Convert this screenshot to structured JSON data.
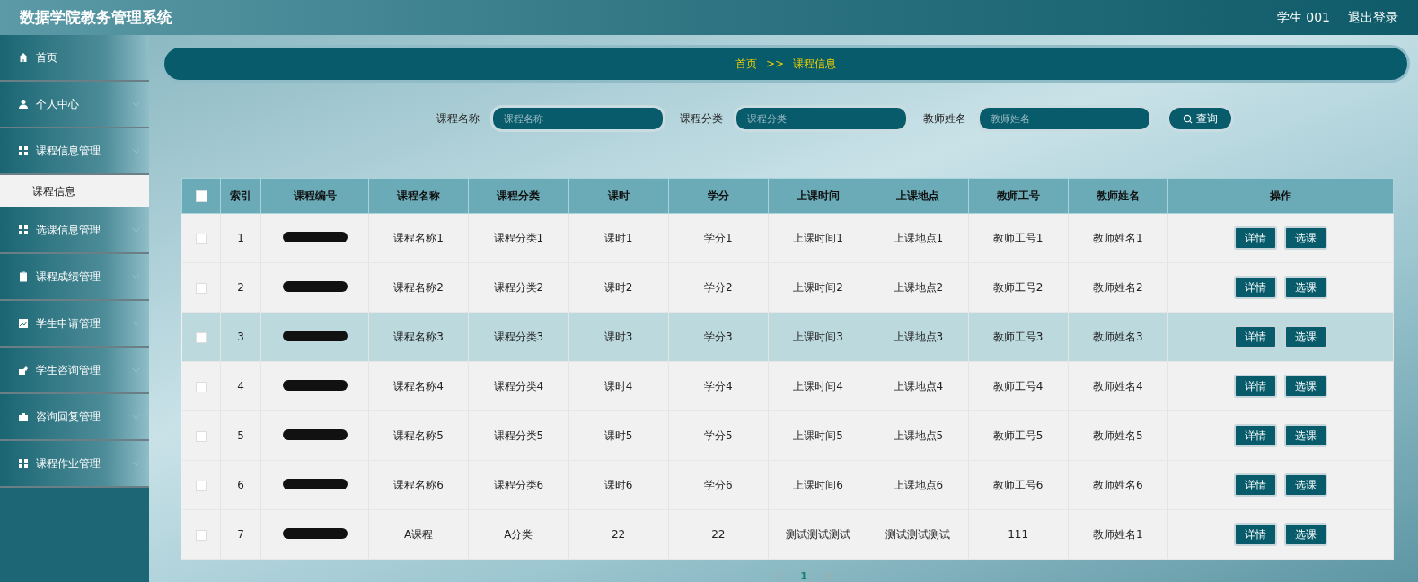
{
  "header": {
    "title": "数据学院教务管理系统",
    "user": "学生 001",
    "logout": "退出登录"
  },
  "sidebar": {
    "items": [
      {
        "label": "首页",
        "expandable": false
      },
      {
        "label": "个人中心",
        "expandable": true
      },
      {
        "label": "课程信息管理",
        "expandable": true,
        "children": [
          {
            "label": "课程信息",
            "selected": true
          }
        ]
      },
      {
        "label": "选课信息管理",
        "expandable": true
      },
      {
        "label": "课程成绩管理",
        "expandable": true
      },
      {
        "label": "学生申请管理",
        "expandable": true
      },
      {
        "label": "学生咨询管理",
        "expandable": true
      },
      {
        "label": "咨询回复管理",
        "expandable": true
      },
      {
        "label": "课程作业管理",
        "expandable": true
      }
    ]
  },
  "breadcrumb": {
    "home": "首页",
    "separator": ">>",
    "current": "课程信息"
  },
  "search": {
    "fields": [
      {
        "label": "课程名称",
        "placeholder": "课程名称"
      },
      {
        "label": "课程分类",
        "placeholder": "课程分类"
      },
      {
        "label": "教师姓名",
        "placeholder": "教师姓名"
      }
    ],
    "button": "查询"
  },
  "table": {
    "select_all_checked": false,
    "columns": [
      "索引",
      "课程编号",
      "课程名称",
      "课程分类",
      "课时",
      "学分",
      "上课时间",
      "上课地点",
      "教师工号",
      "教师姓名",
      "操作"
    ],
    "rows": [
      {
        "checked": false,
        "highlighted": false,
        "cells": [
          "1",
          "",
          "课程名称1",
          "课程分类1",
          "课时1",
          "学分1",
          "上课时间1",
          "上课地点1",
          "教师工号1",
          "教师姓名1"
        ],
        "actions": [
          "详情",
          "选课"
        ]
      },
      {
        "checked": false,
        "highlighted": false,
        "cells": [
          "2",
          "",
          "课程名称2",
          "课程分类2",
          "课时2",
          "学分2",
          "上课时间2",
          "上课地点2",
          "教师工号2",
          "教师姓名2"
        ],
        "actions": [
          "详情",
          "选课"
        ]
      },
      {
        "checked": false,
        "highlighted": true,
        "cells": [
          "3",
          "",
          "课程名称3",
          "课程分类3",
          "课时3",
          "学分3",
          "上课时间3",
          "上课地点3",
          "教师工号3",
          "教师姓名3"
        ],
        "actions": [
          "详情",
          "选课"
        ]
      },
      {
        "checked": false,
        "highlighted": false,
        "cells": [
          "4",
          "",
          "课程名称4",
          "课程分类4",
          "课时4",
          "学分4",
          "上课时间4",
          "上课地点4",
          "教师工号4",
          "教师姓名4"
        ],
        "actions": [
          "详情",
          "选课"
        ]
      },
      {
        "checked": false,
        "highlighted": false,
        "cells": [
          "5",
          "",
          "课程名称5",
          "课程分类5",
          "课时5",
          "学分5",
          "上课时间5",
          "上课地点5",
          "教师工号5",
          "教师姓名5"
        ],
        "actions": [
          "详情",
          "选课"
        ]
      },
      {
        "checked": false,
        "highlighted": false,
        "cells": [
          "6",
          "",
          "课程名称6",
          "课程分类6",
          "课时6",
          "学分6",
          "上课时间6",
          "上课地点6",
          "教师工号6",
          "教师姓名6"
        ],
        "actions": [
          "详情",
          "选课"
        ]
      },
      {
        "checked": false,
        "highlighted": false,
        "cells": [
          "7",
          "",
          "A课程",
          "A分类",
          "22",
          "22",
          "测试测试测试",
          "测试测试测试",
          "111",
          "教师姓名1"
        ],
        "actions": [
          "详情",
          "选课"
        ]
      }
    ]
  },
  "pagination": {
    "pages": [
      {
        "label": "1",
        "selected": true
      }
    ]
  }
}
